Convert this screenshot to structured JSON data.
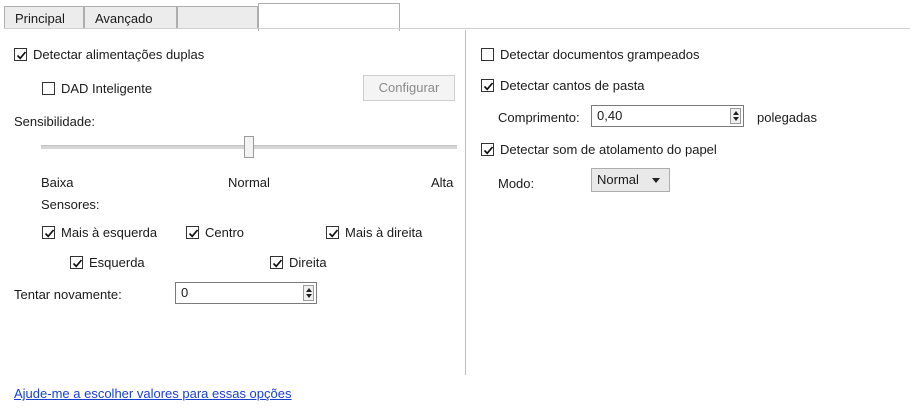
{
  "tabs": [
    {
      "label": "Principal"
    },
    {
      "label": "Avançado"
    },
    {
      "label": ""
    }
  ],
  "left": {
    "double_feed": {
      "label": "Detectar alimentações duplas",
      "checked": true
    },
    "dad": {
      "label": "DAD Inteligente",
      "checked": false
    },
    "configure_button": "Configurar",
    "sensitivity_label": "Sensibilidade:",
    "sensitivity_ticks": {
      "low": "Baixa",
      "mid": "Normal",
      "high": "Alta"
    },
    "sensitivity_level": 0.5,
    "sensors_label": "Sensores:",
    "sensors": {
      "left_most": {
        "label": "Mais à esquerda",
        "checked": true
      },
      "center": {
        "label": "Centro",
        "checked": true
      },
      "right_most": {
        "label": "Mais à direita",
        "checked": true
      },
      "left": {
        "label": "Esquerda",
        "checked": true
      },
      "right": {
        "label": "Direita",
        "checked": true
      }
    },
    "retry_label": "Tentar novamente:",
    "retry_value": "0"
  },
  "right": {
    "stapled": {
      "label": "Detectar documentos grampeados",
      "checked": false
    },
    "folded_corners": {
      "label": "Detectar cantos de pasta",
      "checked": true
    },
    "length_label": "Comprimento:",
    "length_value": "0,40",
    "length_unit": "polegadas",
    "jam_sound": {
      "label": "Detectar som de atolamento do papel",
      "checked": true
    },
    "mode_label": "Modo:",
    "mode_value": "Normal"
  },
  "help_link": "Ajude-me a escolher valores para essas opções",
  "icons": {
    "check": "check-mark-icon",
    "spin_up": "arrow-up-icon",
    "spin_down": "arrow-down-icon",
    "dropdown": "chevron-down-icon"
  }
}
